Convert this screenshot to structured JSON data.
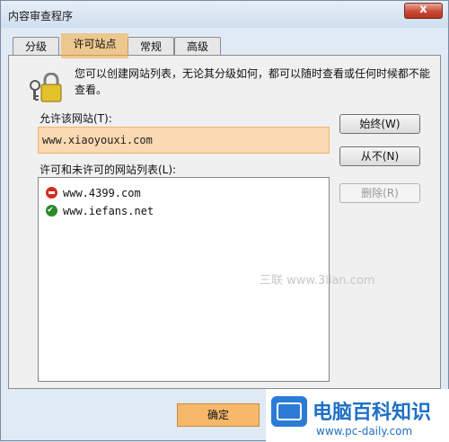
{
  "window": {
    "title": "内容审查程序",
    "close_glyph": "x"
  },
  "tabs": [
    {
      "label": "分级"
    },
    {
      "label": "许可站点"
    },
    {
      "label": "常规"
    },
    {
      "label": "高级"
    }
  ],
  "description": "您可以创建网站列表，无论其分级如何，都可以随时查看或任何时候都不能查看。",
  "allow_label": "允许该网站(T):",
  "url_input": {
    "value": "www.xiaoyouxi.com"
  },
  "buttons": {
    "always": "始终(W)",
    "never": "从不(N)",
    "delete": "删除(R)"
  },
  "list_label": "许可和未许可的网站列表(L):",
  "sites": [
    {
      "url": "www.4399.com",
      "status": "blocked"
    },
    {
      "url": "www.iefans.net",
      "status": "allowed"
    }
  ],
  "watermark": "三联 www.3lian.com",
  "ok_label": "确定",
  "brand": {
    "name": "电脑百科知识",
    "url": "www.pc-daily.com"
  },
  "colors": {
    "highlight": "#f6b86a",
    "blocked": "#d22d22",
    "allowed": "#2e8a2a"
  }
}
